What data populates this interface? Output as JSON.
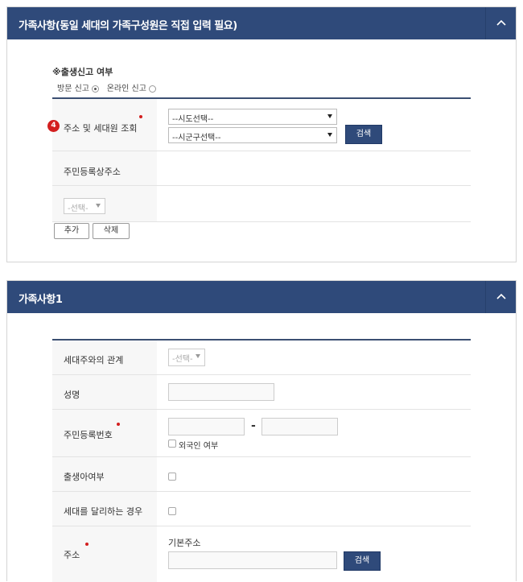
{
  "section1": {
    "title": "가족사항(동일 세대의 가족구성원은 직접 입력 필요)",
    "birth_report": {
      "heading": "※출생신고 여부",
      "option_visit": "방문 신고",
      "option_online": "온라인 신고",
      "selected": "visit"
    },
    "address_lookup": {
      "step_badge": "4",
      "label": "주소 및 세대원 조회",
      "sido_select": "--시도선택--",
      "sigungu_select": "--시군구선택--",
      "search_button": "검색"
    },
    "resident_address_label": "주민등록상주소",
    "member_select": "-선택-",
    "add_button": "추가",
    "delete_button": "삭제"
  },
  "section2": {
    "title": "가족사항1",
    "relation_label": "세대주와의 관계",
    "relation_select": "-선택-",
    "name_label": "성명",
    "rrn_label": "주민등록번호",
    "rrn_dash": "-",
    "foreigner_label": "외국인 여부",
    "newborn_label": "출생아여부",
    "separate_household_label": "세대를 달리하는 경우",
    "address_label": "주소",
    "basic_address_label": "기본주소",
    "search_button": "검색"
  },
  "colors": {
    "header_bg": "#2f4a7a",
    "required_dot": "#d31f1f",
    "table_rule": "#3b4f72"
  }
}
